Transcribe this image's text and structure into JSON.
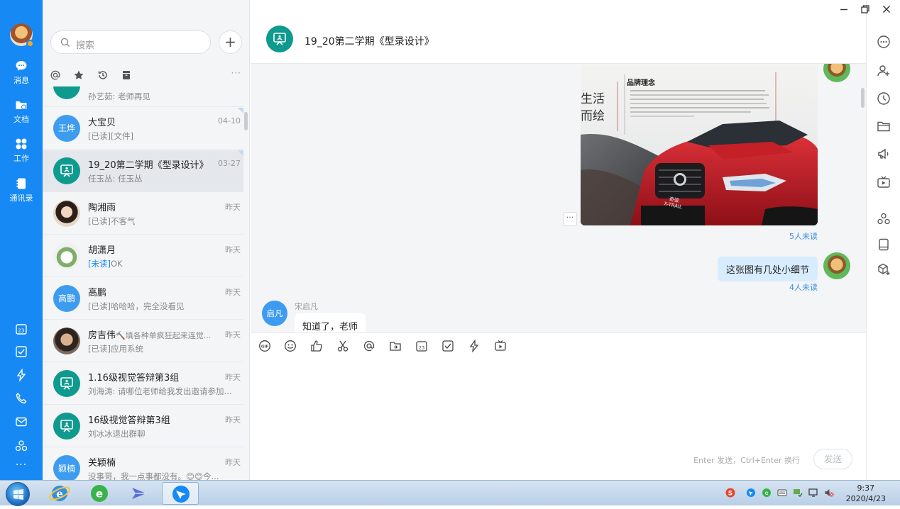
{
  "search": {
    "placeholder": "搜索"
  },
  "nav": {
    "items": [
      {
        "label": "消息"
      },
      {
        "label": "文档"
      },
      {
        "label": "工作"
      },
      {
        "label": "通讯录"
      }
    ]
  },
  "list": {
    "rows": [
      {
        "name": "",
        "preview": "孙艺茹: 老师再见",
        "time": "",
        "avatar": "",
        "avatar_color": "#0e9a8e"
      },
      {
        "name": "大宝贝",
        "preview": "[已读][文件]",
        "time": "04-10",
        "avatar": "王烨",
        "avatar_color": "#3d9cf0"
      },
      {
        "name": "19_20第二学期《型录设计》",
        "preview": "任玉丛: 任玉丛",
        "time": "03-27",
        "avatar": "",
        "avatar_color": "#0e9a8e"
      },
      {
        "name": "陶湘雨",
        "preview": "[已读]不客气",
        "time": "昨天",
        "avatar": "",
        "avatar_color": "#c7a27a"
      },
      {
        "name": "胡潇月",
        "preview_unread": "[未读]",
        "preview": "OK",
        "time": "昨天",
        "avatar": "",
        "avatar_color": "#8fbf7a"
      },
      {
        "name": "高鹏",
        "preview": "[已读]哈哈哈，完全没看见",
        "time": "昨天",
        "avatar": "高鹏",
        "avatar_color": "#3d9cf0"
      },
      {
        "name": "房吉伟",
        "name_sub": "🔨填各种单疯狂起来连觉...",
        "preview": "[已读]应用系统",
        "time": "昨天",
        "avatar": "",
        "avatar_color": "#5a4a3e"
      },
      {
        "name": "1.16级视觉答辩第3组",
        "preview": "刘海涛: 请哪位老师给我发出邀请参加...",
        "time": "昨天",
        "avatar": "",
        "avatar_color": "#0e9a8e"
      },
      {
        "name": "16级视觉答辩第3组",
        "preview": "刘冰冰退出群聊",
        "time": "昨天",
        "avatar": "",
        "avatar_color": "#0e9a8e"
      },
      {
        "name": "关颖楠",
        "preview": "没事哥，我一点事都没有。😊😊今...",
        "time": "昨天",
        "avatar": "颖楠",
        "avatar_color": "#3d9cf0"
      }
    ]
  },
  "chat": {
    "title": "19_20第二学期《型录设计》",
    "image": {
      "heading": "品牌理念",
      "tagline_1": "生活",
      "tagline_2": "而绘",
      "badge": "奇骏",
      "badge_sub": "X-TRAIL"
    },
    "read_1": "5人未读",
    "my_message": "这张图有几处小细节",
    "read_2": "4人未读",
    "sender_name": "宋启凡",
    "sender_avatar": "启凡",
    "other_message": "知道了，老师",
    "more": "···"
  },
  "composer": {
    "hint": "Enter 发送，Ctrl+Enter 换行",
    "send": "发送"
  },
  "taskbar": {
    "time": "9:37",
    "date": "2020/4/23"
  },
  "colors": {
    "brand": "#1689f5",
    "group": "#0e9a8e",
    "avatar_blue": "#3d9cf0"
  }
}
